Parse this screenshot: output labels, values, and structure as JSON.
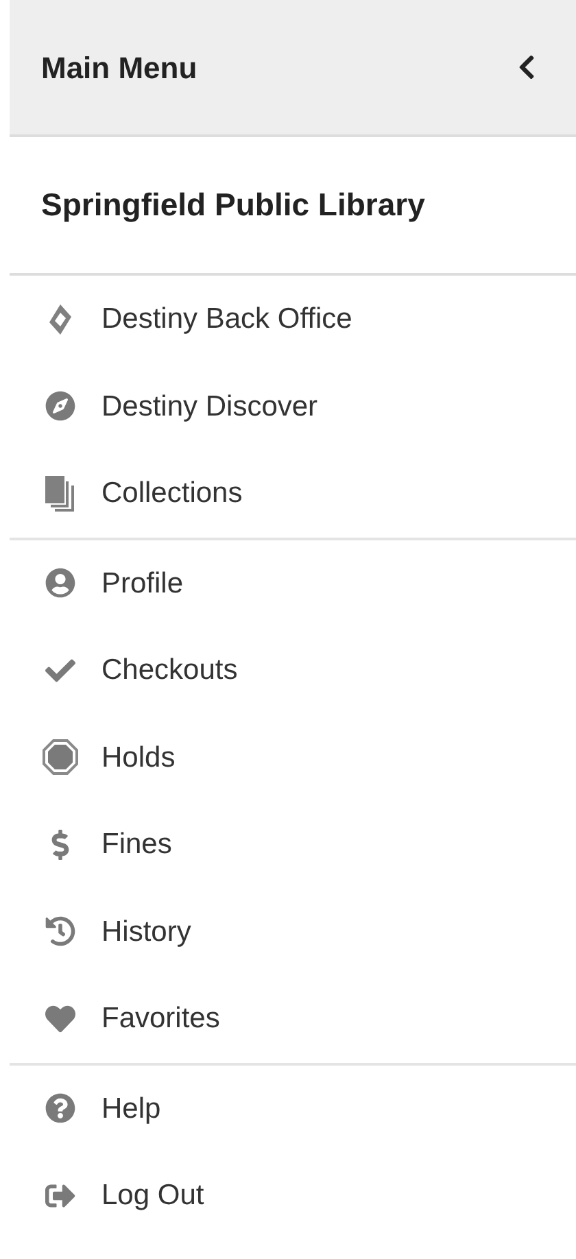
{
  "header": {
    "title": "Main Menu"
  },
  "library": "Springfield Public Library",
  "groups": [
    [
      {
        "kind": "diamond",
        "label": "Destiny Back Office"
      },
      {
        "kind": "compass",
        "label": "Destiny Discover"
      },
      {
        "kind": "stack",
        "label": "Collections"
      }
    ],
    [
      {
        "kind": "user",
        "label": "Profile"
      },
      {
        "kind": "check",
        "label": "Checkouts"
      },
      {
        "kind": "octagon",
        "label": "Holds"
      },
      {
        "kind": "dollar",
        "label": "Fines"
      },
      {
        "kind": "history",
        "label": "History"
      },
      {
        "kind": "heart",
        "label": "Favorites"
      }
    ],
    [
      {
        "kind": "help",
        "label": "Help"
      },
      {
        "kind": "logout",
        "label": "Log Out"
      }
    ]
  ]
}
